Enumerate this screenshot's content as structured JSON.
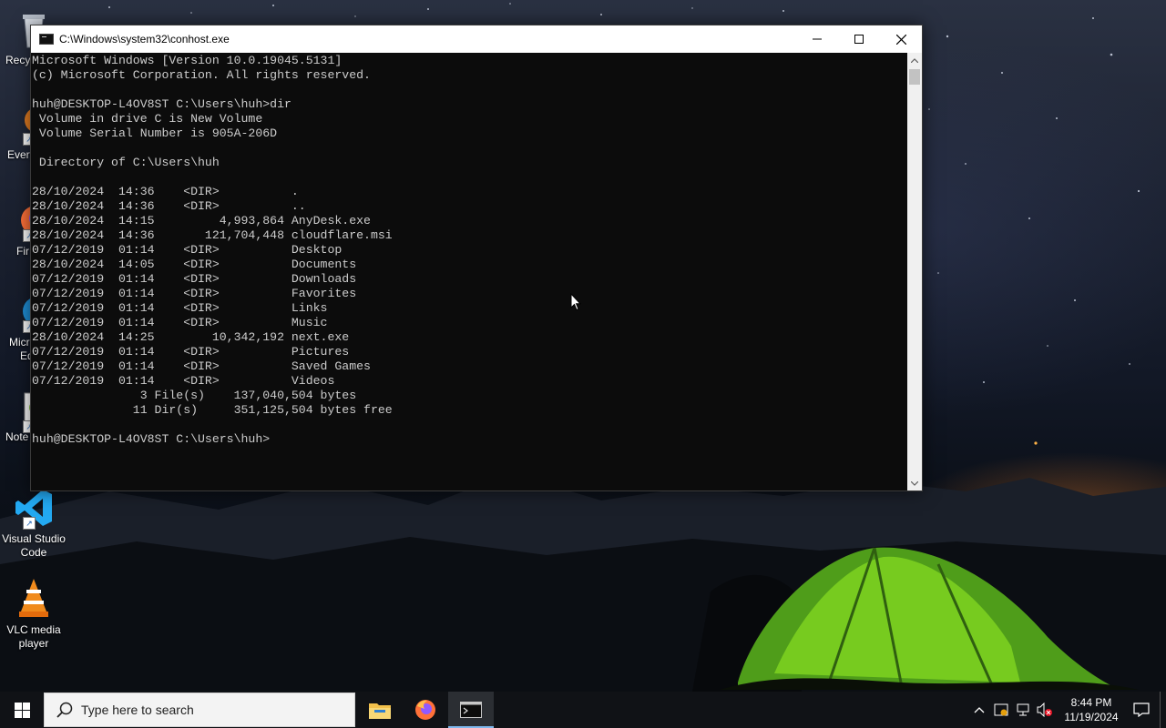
{
  "window": {
    "title": "C:\\Windows\\system32\\conhost.exe"
  },
  "console_lines": [
    "Microsoft Windows [Version 10.0.19045.5131]",
    "(c) Microsoft Corporation. All rights reserved.",
    "",
    "huh@DESKTOP-L4OV8ST C:\\Users\\huh>dir",
    " Volume in drive C is New Volume",
    " Volume Serial Number is 905A-206D",
    "",
    " Directory of C:\\Users\\huh",
    "",
    "28/10/2024  14:36    <DIR>          .",
    "28/10/2024  14:36    <DIR>          ..",
    "28/10/2024  14:15         4,993,864 AnyDesk.exe",
    "28/10/2024  14:36       121,704,448 cloudflare.msi",
    "07/12/2019  01:14    <DIR>          Desktop",
    "28/10/2024  14:05    <DIR>          Documents",
    "07/12/2019  01:14    <DIR>          Downloads",
    "07/12/2019  01:14    <DIR>          Favorites",
    "07/12/2019  01:14    <DIR>          Links",
    "07/12/2019  01:14    <DIR>          Music",
    "28/10/2024  14:25        10,342,192 next.exe",
    "07/12/2019  01:14    <DIR>          Pictures",
    "07/12/2019  01:14    <DIR>          Saved Games",
    "07/12/2019  01:14    <DIR>          Videos",
    "               3 File(s)    137,040,504 bytes",
    "              11 Dir(s)     351,125,504 bytes free",
    "",
    "huh@DESKTOP-L4OV8ST C:\\Users\\huh>"
  ],
  "desktop_icons": [
    {
      "label": "Recy",
      "icon": "recycle-bin-icon"
    },
    {
      "label": "Every",
      "icon": "everything-search-icon"
    },
    {
      "label": "Fir",
      "icon": "firefox-icon"
    },
    {
      "label": "Micr",
      "label2": "Ed",
      "icon": "edge-icon"
    },
    {
      "label": "Note",
      "icon": "notepad-plus-plus-icon"
    },
    {
      "label": "Visual Studio",
      "label2": "Code",
      "icon": "vscode-icon"
    },
    {
      "label": "VLC media",
      "label2": "player",
      "icon": "vlc-icon"
    }
  ],
  "taskbar": {
    "search_placeholder": "Type here to search",
    "apps": [
      "file-explorer-icon",
      "firefox-icon",
      "console-icon"
    ],
    "time": "8:44 PM",
    "date": "11/19/2024"
  },
  "colors": {
    "console_bg": "#0c0c0c",
    "console_text": "#cccccc",
    "taskbar_bg": "#101216",
    "active_indicator": "#7fb8ee"
  }
}
